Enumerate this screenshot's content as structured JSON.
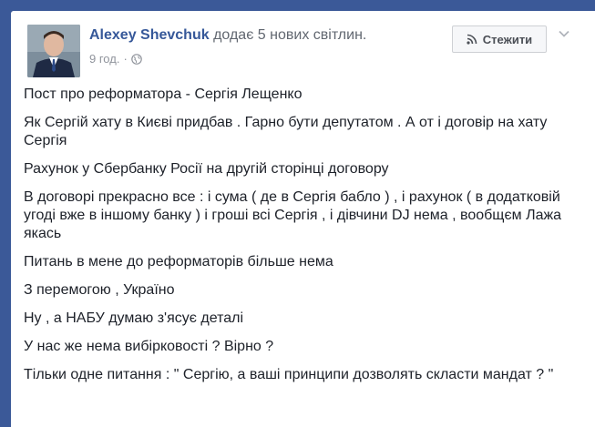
{
  "post": {
    "author_name": "Alexey Shevchuk",
    "action_text": " додає 5 нових світлин.",
    "time": "9 год.",
    "dot": "·",
    "follow_label": "Стежити",
    "paragraphs": [
      "Пост про реформатора - Сергія Лещенко",
      "Як Сергій хату в Києві придбав . Гарно бути депутатом . А от і договір на хату Сергія",
      "Рахунок у Сбербанку Росії на другій сторінці договору",
      "В договорі прекрасно все : і сума ( де в Сергія бабло ) , і рахунок ( в додатковій угоді вже в іншому банку ) і гроші всі Сергія , і дівчини DJ нема , вообщєм Лажа якась",
      "Питань в мене до реформаторів більше нема",
      "З перемогою , Україно",
      "Ну , а НАБУ думаю з'ясує деталі",
      "У нас же нема вибірковості ? Вірно ?",
      "Тільки одне питання : \" Сергію, а ваші принципи дозволять скласти мандат ? \""
    ]
  },
  "colors": {
    "page_bg": "#3b5998",
    "author_link": "#365899",
    "meta_text": "#90949c"
  },
  "icons": {
    "privacy": "globe-icon",
    "follow": "rss-icon",
    "menu": "chevron-down-icon"
  }
}
